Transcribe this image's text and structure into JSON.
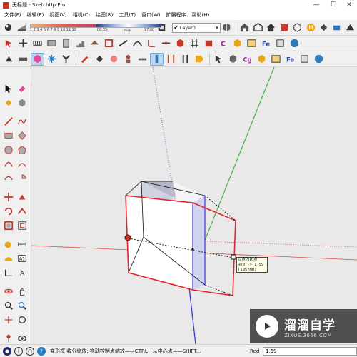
{
  "window": {
    "title": "无标题 - SketchUp Pro",
    "minimize": "—",
    "maximize": "☐",
    "close": "✕"
  },
  "menu": [
    "文件(F)",
    "编辑(E)",
    "视图(V)",
    "相机(C)",
    "绘图(R)",
    "工具(T)",
    "窗口(W)",
    "扩展程序",
    "帮助(H)"
  ],
  "shadows": {
    "months": "1 2 3 4 5 6 7 8 9 10 11 12",
    "time_start": "06:55",
    "time_mid": "中午",
    "time_end": "17:00"
  },
  "layer": {
    "check": "✔",
    "value": "Layer0",
    "arrow": "▾"
  },
  "tooltip": {
    "line1": "以点为起点",
    "line2": "Red -> 1.59",
    "line3": "[1957mm]"
  },
  "watermark": {
    "name": "溜溜自学",
    "url": "ZIXUE.3066.COM"
  },
  "status": {
    "hint": "变形框 收分缩放: 拖动控制点缩放——CTRL：从中心点——SHIFT...",
    "vcb_label": "Red",
    "vcb_value": "1.59"
  },
  "colors": {
    "red_axis": "#d94a3c",
    "green_axis": "#2fa52f",
    "blue_axis": "#3a3ad8",
    "selection": "#e0262d",
    "face": "#ffffff",
    "face_back": "#bcbcd2"
  }
}
